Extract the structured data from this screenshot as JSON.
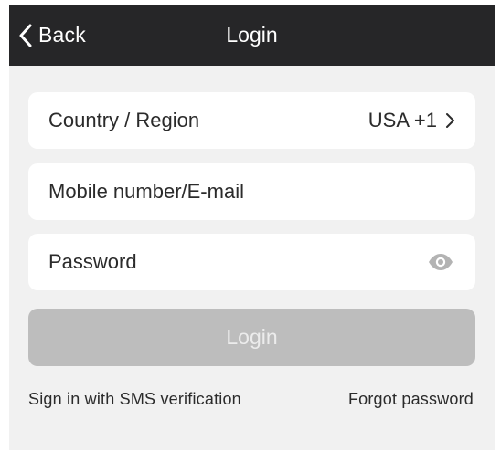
{
  "nav": {
    "back_label": "Back",
    "title": "Login"
  },
  "form": {
    "country_label": "Country / Region",
    "country_value": "USA +1",
    "mobile_placeholder": "Mobile number/E-mail",
    "password_placeholder": "Password",
    "login_label": "Login"
  },
  "links": {
    "sms_signin": "Sign in with SMS verification",
    "forgot_password": "Forgot password"
  },
  "icons": {
    "back": "chevron-left-icon",
    "country_chevron": "chevron-right-icon",
    "password_toggle": "eye-icon"
  },
  "colors": {
    "nav_background": "#262628",
    "screen_background": "#f1f1f1",
    "field_background": "#ffffff",
    "login_button_disabled": "#bdbdbd",
    "login_text_disabled": "#ececec"
  }
}
